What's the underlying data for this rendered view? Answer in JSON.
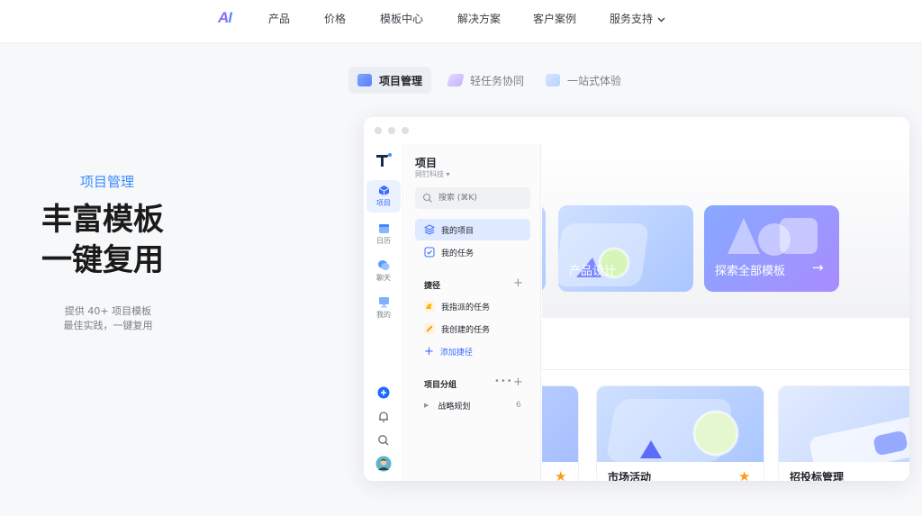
{
  "nav": {
    "logo_a": "A",
    "logo_i": "I",
    "items": [
      "产品",
      "价格",
      "模板中心",
      "解决方案",
      "客户案例",
      "服务支持"
    ]
  },
  "hero_tabs": [
    {
      "label": "项目管理",
      "active": true
    },
    {
      "label": "轻任务协同",
      "active": false
    },
    {
      "label": "一站式体验",
      "active": false
    }
  ],
  "hero": {
    "kicker": "项目管理",
    "headline_1": "丰富模板",
    "headline_2": "一键复用",
    "sub_1": "提供 40+ 项目模板",
    "sub_2": "最佳实践，一键复用"
  },
  "rail": {
    "items": [
      {
        "label": "项目",
        "icon": "cube-icon",
        "active": true
      },
      {
        "label": "日历",
        "icon": "calendar-icon"
      },
      {
        "label": "聊天",
        "icon": "chat-icon"
      },
      {
        "label": "我的",
        "icon": "monitor-icon"
      }
    ],
    "bottom": [
      "add-circle-icon",
      "bell-icon",
      "search-icon",
      "avatar"
    ]
  },
  "panel": {
    "title": "项目",
    "org": "网钉科技",
    "search_placeholder": "搜索 (⌘K)",
    "my_projects": "我的项目",
    "my_tasks": "我的任务",
    "shortcuts_title": "捷径",
    "assigned_tasks": "我指派的任务",
    "created_tasks": "我创建的任务",
    "add_shortcut": "添加捷径",
    "group_title": "项目分组",
    "group_item": "战略规划",
    "group_count": "6"
  },
  "templates": {
    "card_1": "产品设计",
    "card_2": "探索全部模板",
    "arrow": "→"
  },
  "lower_cards": {
    "card_2": "市场活动",
    "card_3": "招投标管理"
  },
  "colors": {
    "accent": "#3b6dff",
    "kicker": "#3b8cff",
    "star": "#ff9a1f"
  }
}
